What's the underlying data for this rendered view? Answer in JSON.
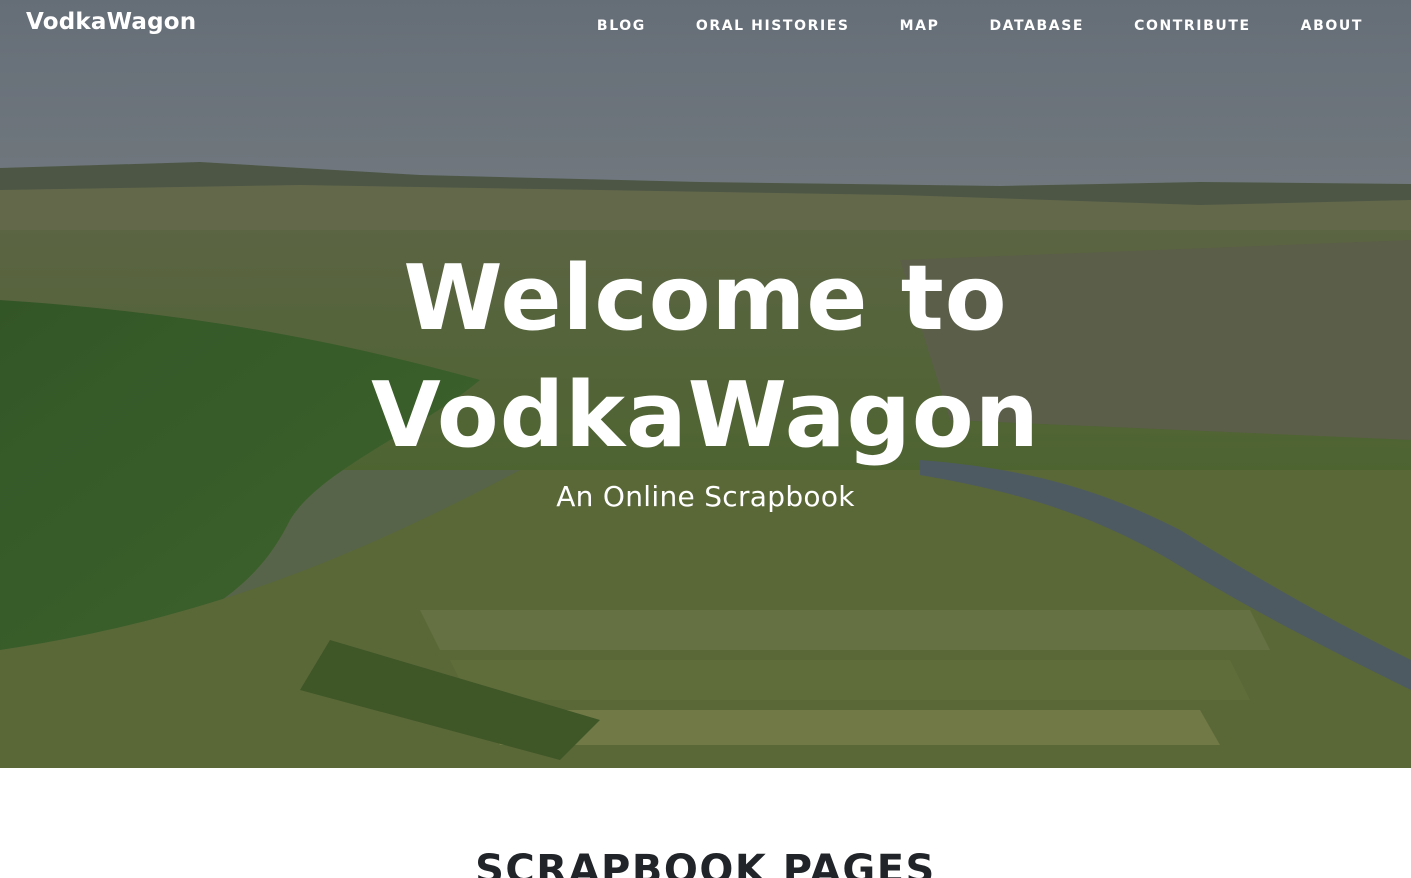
{
  "navbar": {
    "brand": "VodkaWagon",
    "links": [
      {
        "label": "BLOG"
      },
      {
        "label": "ORAL HISTORIES"
      },
      {
        "label": "MAP"
      },
      {
        "label": "DATABASE"
      },
      {
        "label": "CONTRIBUTE"
      },
      {
        "label": "ABOUT"
      }
    ]
  },
  "hero": {
    "title_line1": "Welcome to",
    "title_line2": "VodkaWagon",
    "subtitle": "An Online Scrapbook",
    "background": "aerial-landscape-photo"
  },
  "section": {
    "heading": "SCRAPBOOK PAGES"
  },
  "colors": {
    "nav_text": "#ffffff",
    "hero_text": "#ffffff",
    "heading_text": "#212529",
    "page_background": "#ffffff"
  }
}
